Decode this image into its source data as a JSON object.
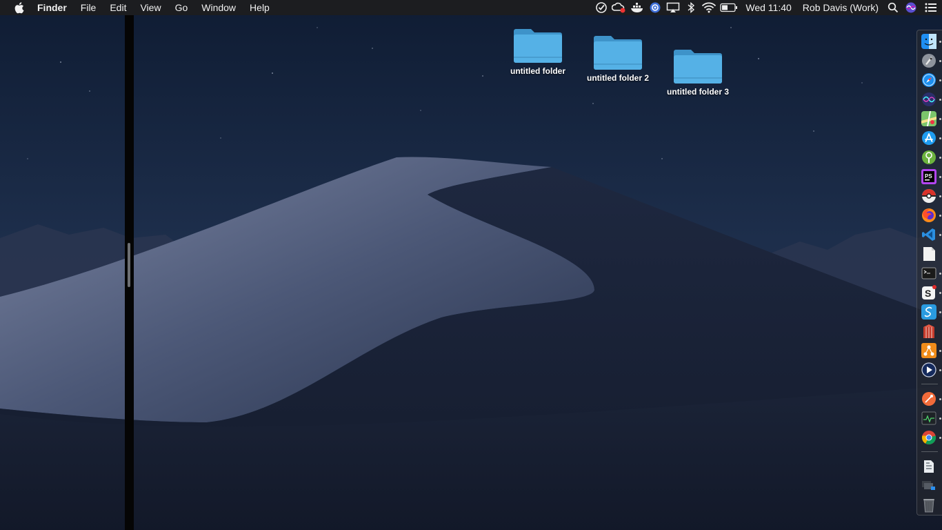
{
  "menubar": {
    "app_name": "Finder",
    "menus": [
      "File",
      "Edit",
      "View",
      "Go",
      "Window",
      "Help"
    ],
    "clock": "Wed 11:40",
    "user": "Rob Davis (Work)"
  },
  "desktop": {
    "folders": [
      {
        "label": "untitled folder"
      },
      {
        "label": "untitled folder 2"
      },
      {
        "label": "untitled folder 3"
      }
    ]
  },
  "dock": {
    "apps": [
      {
        "icon": "finder-icon",
        "running": true
      },
      {
        "icon": "launchpad-icon",
        "running": true
      },
      {
        "icon": "safari-icon",
        "running": true
      },
      {
        "icon": "siri-icon",
        "running": true
      },
      {
        "icon": "maps-icon",
        "running": true
      },
      {
        "icon": "app-store-icon",
        "running": true
      },
      {
        "icon": "sourcetree-icon",
        "running": true
      },
      {
        "icon": "phpstorm-icon",
        "running": true
      },
      {
        "icon": "pokeball-icon",
        "running": true
      },
      {
        "icon": "firefox-icon",
        "running": true
      },
      {
        "icon": "vscode-icon",
        "running": true
      },
      {
        "icon": "document-icon",
        "running": false
      },
      {
        "icon": "terminal-icon",
        "running": true
      },
      {
        "icon": "slack-icon",
        "running": true,
        "badge": true
      },
      {
        "icon": "sequel-icon",
        "running": true
      },
      {
        "icon": "archive-icon",
        "running": false
      },
      {
        "icon": "share-icon",
        "running": true
      },
      {
        "icon": "video-player-icon",
        "running": true
      },
      {
        "icon": "postman-icon",
        "running": true
      },
      {
        "icon": "activity-monitor-icon",
        "running": true
      },
      {
        "icon": "chrome-icon",
        "running": true
      },
      {
        "icon": "downloads-icon",
        "running": false
      },
      {
        "icon": "window-stack-icon",
        "running": false
      },
      {
        "icon": "trash-icon",
        "running": false
      }
    ]
  },
  "colors": {
    "folder": "#4aa8de",
    "menubar_bg": "#1c1d20",
    "sky": "#1a2a45"
  }
}
